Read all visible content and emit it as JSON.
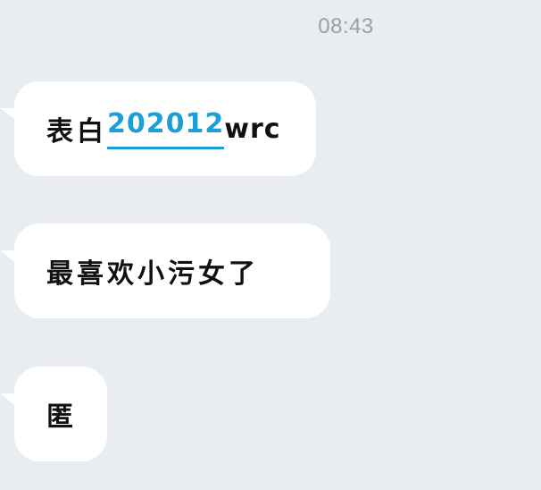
{
  "header": {
    "timestamp": "08:43"
  },
  "messages": [
    {
      "prefix": "表白",
      "link": "202012",
      "suffix": "wrc"
    },
    {
      "text": "最喜欢小污女了"
    },
    {
      "text": "匿"
    }
  ],
  "colors": {
    "background": "#e9ecf0",
    "bubble": "#ffffff",
    "link": "#1e9ed6",
    "timestamp": "#9aa0a6"
  }
}
